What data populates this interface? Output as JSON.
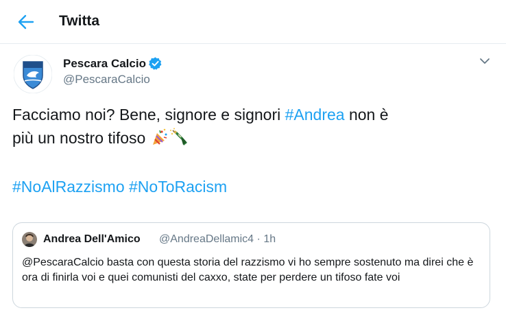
{
  "header": {
    "back_icon": "arrow-left-icon",
    "title": "Twitta"
  },
  "tweet": {
    "author_name": "Pescara Calcio",
    "author_handle": "@PescaraCalcio",
    "verified_icon": "verified-badge-icon",
    "more_icon": "chevron-down-icon",
    "text_part1": "Facciamo noi? Bene, signore e signori ",
    "mention_tag": "#Andrea",
    "text_part2": " non è",
    "text_line2": "più un nostro tifoso ",
    "emojis": [
      "party-popper-icon",
      "champagne-icon"
    ],
    "hashtags": [
      "#NoAlRazzismo",
      "#NoToRacism"
    ]
  },
  "quoted_tweet": {
    "author_name": "Andrea Dell'Amico",
    "author_handle": "@AndreaDellamic4",
    "separator": "·",
    "time": "1h",
    "text": "@PescaraCalcio basta con questa storia del razzismo vi ho sempre sostenuto ma direi che è ora di finirla voi e quei comunisti del caxxo, state per perdere un tifoso fate voi"
  },
  "colors": {
    "accent": "#1da1f2",
    "secondary_text": "#657786",
    "border": "#e6ecf0"
  }
}
